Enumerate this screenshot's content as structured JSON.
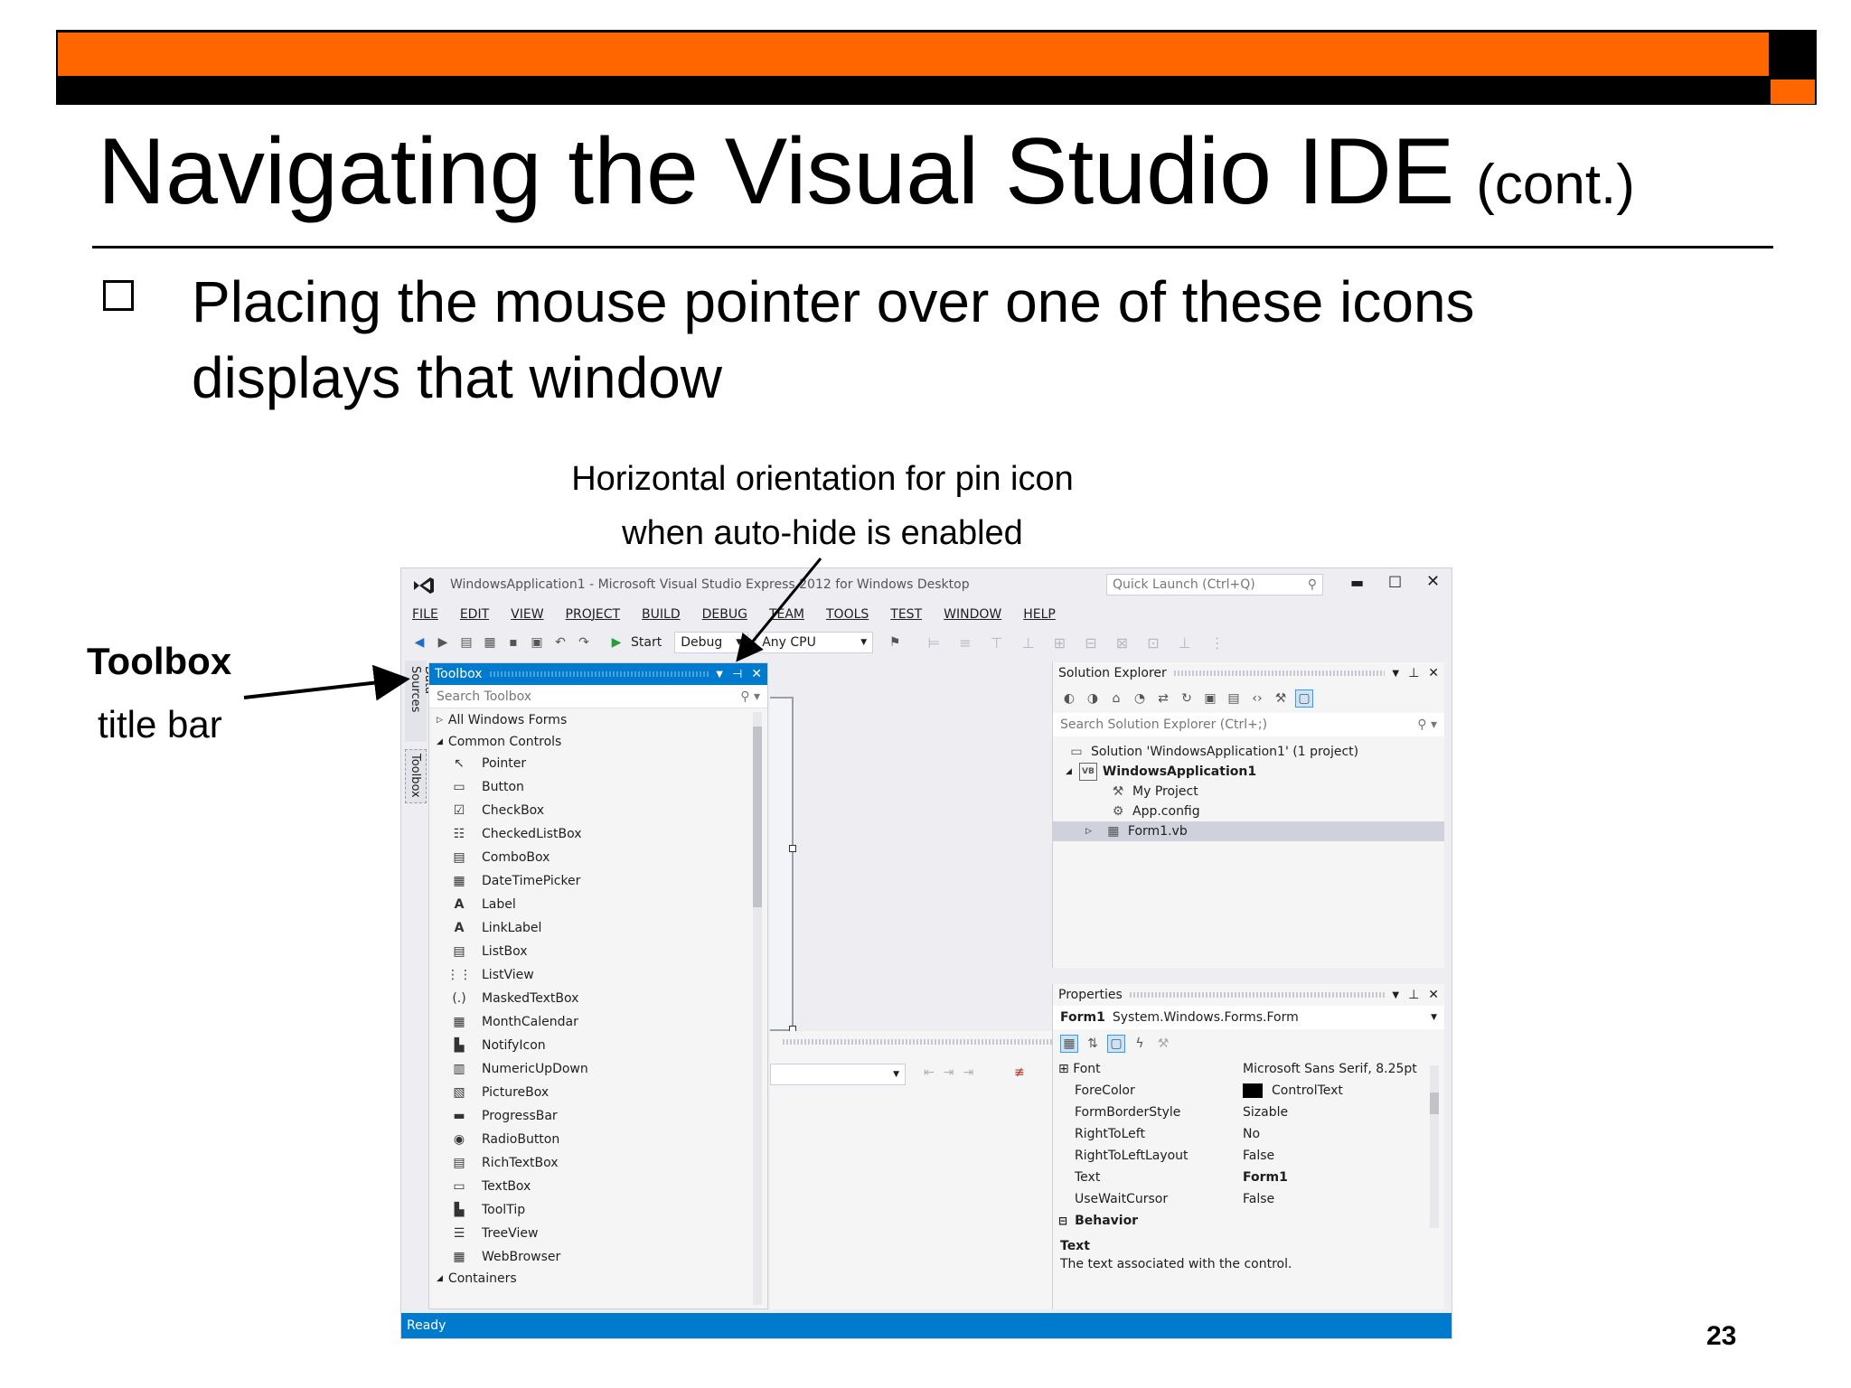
{
  "slide": {
    "title": "Navigating the Visual Studio IDE",
    "title_suffix": "(cont.)",
    "bullet": "Placing the mouse pointer over one of these icons displays that window",
    "callout_pin_line1": "Horizontal orientation for pin icon",
    "callout_pin_line2": "when auto-hide is enabled",
    "callout_toolbox_line1": "Toolbox",
    "callout_toolbox_line2": "title bar",
    "page_number": "23",
    "colors": {
      "accent": "#ff6600",
      "bar": "#000000",
      "vs_blue": "#007acc"
    }
  },
  "vs": {
    "window_title": "WindowsApplication1 - Microsoft Visual Studio Express 2012 for Windows Desktop",
    "quick_launch_placeholder": "Quick Launch (Ctrl+Q)",
    "menu": [
      "FILE",
      "EDIT",
      "VIEW",
      "PROJECT",
      "BUILD",
      "DEBUG",
      "TEAM",
      "TOOLS",
      "TEST",
      "WINDOW",
      "HELP"
    ],
    "toolbar": {
      "start_label": "Start",
      "config": "Debug",
      "platform": "Any CPU"
    },
    "side_tabs": {
      "data_sources": "Data Sources",
      "toolbox": "Toolbox"
    },
    "toolbox": {
      "title": "Toolbox",
      "search_placeholder": "Search Toolbox",
      "group_all": "All Windows Forms",
      "group_common": "Common Controls",
      "items": [
        "Pointer",
        "Button",
        "CheckBox",
        "CheckedListBox",
        "ComboBox",
        "DateTimePicker",
        "Label",
        "LinkLabel",
        "ListBox",
        "ListView",
        "MaskedTextBox",
        "MonthCalendar",
        "NotifyIcon",
        "NumericUpDown",
        "PictureBox",
        "ProgressBar",
        "RadioButton",
        "RichTextBox",
        "TextBox",
        "ToolTip",
        "TreeView",
        "WebBrowser"
      ],
      "group_containers": "Containers"
    },
    "solution_explorer": {
      "title": "Solution Explorer",
      "search_placeholder": "Search Solution Explorer (Ctrl+;)",
      "solution": "Solution 'WindowsApplication1' (1 project)",
      "project": "WindowsApplication1",
      "items": [
        "My Project",
        "App.config",
        "Form1.vb"
      ]
    },
    "properties": {
      "title": "Properties",
      "object": "Form1",
      "object_type": "System.Windows.Forms.Form",
      "rows": [
        {
          "name": "Font",
          "value": "Microsoft Sans Serif, 8.25pt"
        },
        {
          "name": "ForeColor",
          "value": "ControlText"
        },
        {
          "name": "FormBorderStyle",
          "value": "Sizable"
        },
        {
          "name": "RightToLeft",
          "value": "No"
        },
        {
          "name": "RightToLeftLayout",
          "value": "False"
        },
        {
          "name": "Text",
          "value": "Form1"
        },
        {
          "name": "UseWaitCursor",
          "value": "False"
        }
      ],
      "category": "Behavior",
      "desc_title": "Text",
      "desc_text": "The text associated with the control."
    },
    "status": "Ready"
  }
}
